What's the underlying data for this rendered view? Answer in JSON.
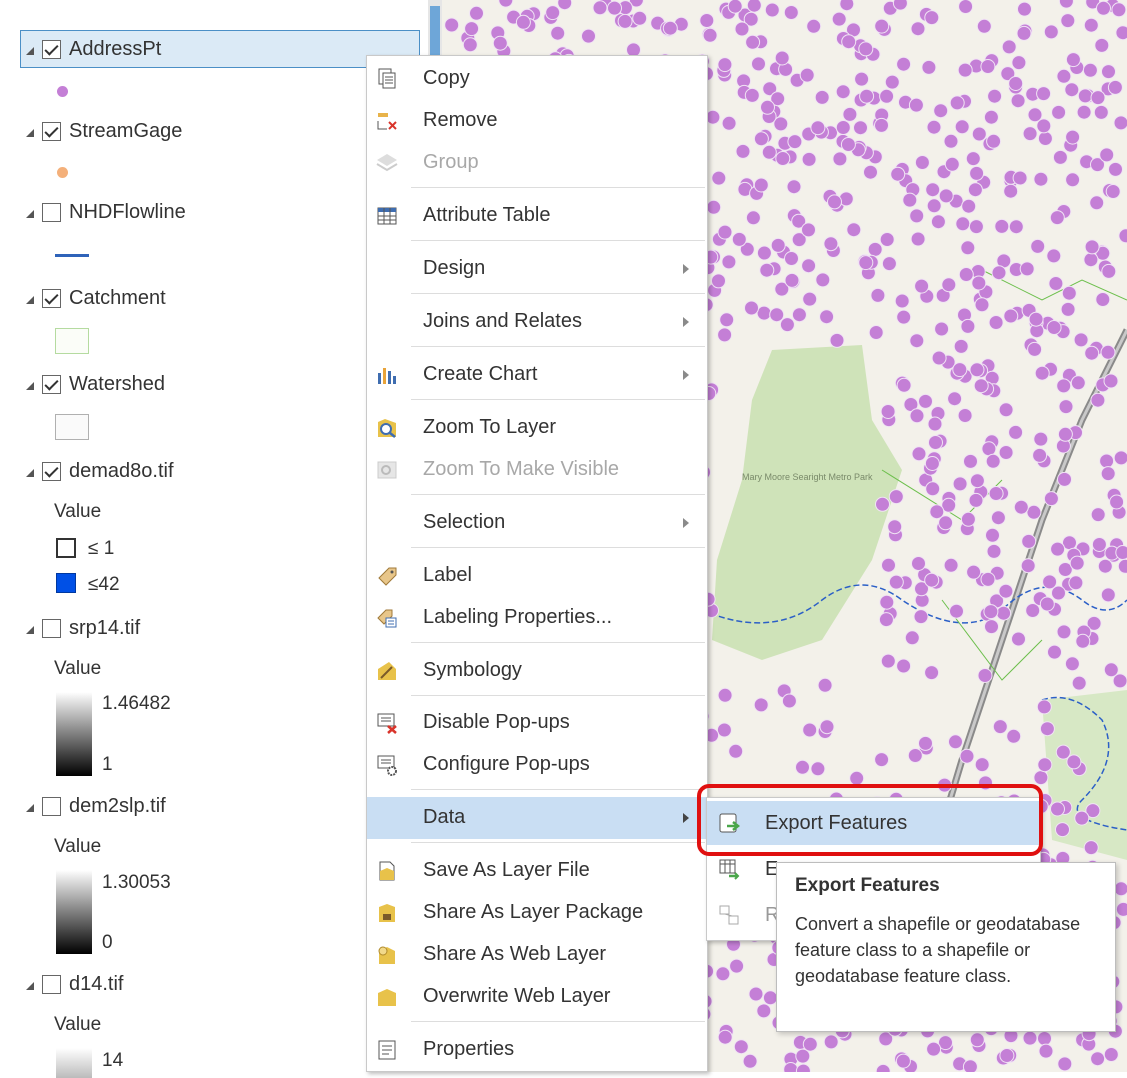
{
  "contents": {
    "layers": [
      {
        "name": "AddressPt",
        "checked": true,
        "selected": true,
        "symbol": "purple-point"
      },
      {
        "name": "StreamGage",
        "checked": true,
        "symbol": "orange-point"
      },
      {
        "name": "NHDFlowline",
        "checked": false,
        "symbol": "blue-line"
      },
      {
        "name": "Catchment",
        "checked": true,
        "symbol": "green-outline-polygon"
      },
      {
        "name": "Watershed",
        "checked": true,
        "symbol": "gray-outline-polygon"
      },
      {
        "name": "demad8o.tif",
        "checked": true,
        "legend_title": "Value",
        "classes": [
          {
            "label": "≤ 1",
            "color": "#ffffff"
          },
          {
            "label": "≤42",
            "color": "#0050e6"
          }
        ]
      },
      {
        "name": "srp14.tif",
        "checked": false,
        "legend_title": "Value",
        "high": "1.46482",
        "low": "1"
      },
      {
        "name": "dem2slp.tif",
        "checked": false,
        "legend_title": "Value",
        "high": "1.30053",
        "low": "0"
      },
      {
        "name": "d14.tif",
        "checked": false,
        "legend_title": "Value",
        "high": "14"
      }
    ]
  },
  "map": {
    "park_label": "Mary Moore Searight Metro Park",
    "point_color": "#c47fd6",
    "base_color": "#f3f1ea",
    "park_color": "#cfe3b9"
  },
  "context_menu": {
    "items": [
      {
        "label": "Copy",
        "icon": "copy-icon"
      },
      {
        "label": "Remove",
        "icon": "remove-icon"
      },
      {
        "label": "Group",
        "icon": "group-icon",
        "disabled": true
      },
      {
        "label": "Attribute Table",
        "icon": "table-icon"
      },
      {
        "label": "Design",
        "submenu": true
      },
      {
        "label": "Joins and Relates",
        "submenu": true
      },
      {
        "label": "Create Chart",
        "icon": "chart-icon",
        "submenu": true
      },
      {
        "label": "Zoom To Layer",
        "icon": "zoom-layer-icon"
      },
      {
        "label": "Zoom To Make Visible",
        "icon": "zoom-visible-icon",
        "disabled": true
      },
      {
        "label": "Selection",
        "submenu": true
      },
      {
        "label": "Label",
        "icon": "label-icon"
      },
      {
        "label": "Labeling Properties...",
        "icon": "labeling-properties-icon"
      },
      {
        "label": "Symbology",
        "icon": "symbology-icon"
      },
      {
        "label": "Disable Pop-ups",
        "icon": "disable-popups-icon"
      },
      {
        "label": "Configure Pop-ups",
        "icon": "configure-popups-icon"
      },
      {
        "label": "Data",
        "submenu": true,
        "highlighted": true
      },
      {
        "label": "Save As Layer File",
        "icon": "save-layer-file-icon"
      },
      {
        "label": "Share As Layer Package",
        "icon": "share-package-icon"
      },
      {
        "label": "Share As Web Layer",
        "icon": "share-web-layer-icon"
      },
      {
        "label": "Overwrite Web Layer",
        "icon": "overwrite-web-layer-icon"
      },
      {
        "label": "Properties",
        "icon": "properties-icon"
      }
    ]
  },
  "data_submenu": {
    "items": [
      {
        "label": "Export Features",
        "icon": "export-features-icon",
        "highlighted": true
      },
      {
        "label": "E",
        "icon": "export-table-icon"
      },
      {
        "label": "R",
        "icon": "relate-icon"
      }
    ]
  },
  "tooltip": {
    "title": "Export Features",
    "description": "Convert a shapefile or geodatabase feature class to a shapefile or geodatabase feature class."
  }
}
